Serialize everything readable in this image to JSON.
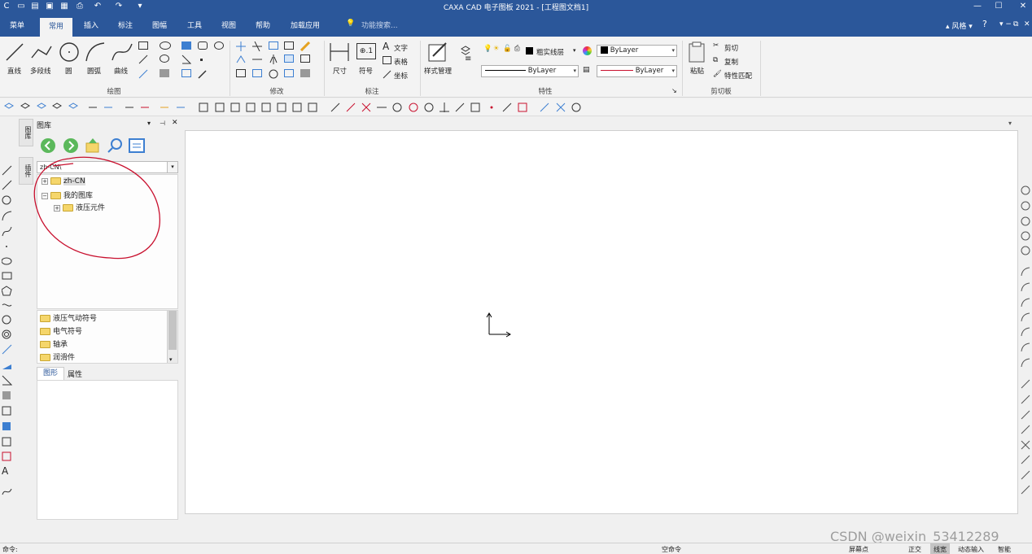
{
  "app": {
    "title": "CAXA CAD 电子图板 2021 - [工程图文档1]"
  },
  "menu": {
    "tabs": [
      "菜单",
      "常用",
      "插入",
      "标注",
      "图幅",
      "工具",
      "视图",
      "帮助",
      "加载应用"
    ],
    "active_tab": "常用",
    "search_placeholder": "功能搜索...",
    "style_label": "风格"
  },
  "ribbon": {
    "draw": {
      "label": "绘图",
      "line": "直线",
      "polyline": "多段线",
      "circle": "圆",
      "arc": "圆弧",
      "curve": "曲线"
    },
    "modify": {
      "label": "修改"
    },
    "annotate": {
      "label": "标注",
      "dimension": "尺寸",
      "symbol": "符号",
      "text": "文字",
      "table": "表格",
      "coordinate": "坐标"
    },
    "properties": {
      "label": "特性",
      "style_manager": "样式管理",
      "layer": "粗实线层",
      "color": "ByLayer",
      "linetype": "ByLayer",
      "lineweight": "ByLayer"
    },
    "clipboard": {
      "label": "剪切板",
      "paste": "粘贴",
      "cut": "剪切",
      "copy": "复制",
      "match": "特性匹配"
    }
  },
  "panel": {
    "title": "图库",
    "vtab1": "图库",
    "vtab2": "插件",
    "path": "zh-CN\\",
    "tree": [
      {
        "label": "zh-CN",
        "level": 0,
        "expander": "+"
      },
      {
        "label": "我的图库",
        "level": 0,
        "expander": "−"
      },
      {
        "label": "液压元件",
        "level": 1,
        "expander": "+"
      }
    ],
    "list": [
      "液压气动符号",
      "电气符号",
      "轴承",
      "润滑件"
    ],
    "tabs": [
      "图形",
      "属性"
    ]
  },
  "status": {
    "command_label": "命令:",
    "empty_command": "空命令",
    "screen_point": "屏幕点",
    "ortho": "正交",
    "lineweight": "线宽",
    "dynamic_input": "动态输入",
    "smart": "智能"
  },
  "watermark": "CSDN @weixin_53412289",
  "colors": {
    "titlebar": "#2b579a",
    "ribbon": "#f3f3f3",
    "annotation_red": "#c8102e",
    "folder": "#f5d66b"
  }
}
